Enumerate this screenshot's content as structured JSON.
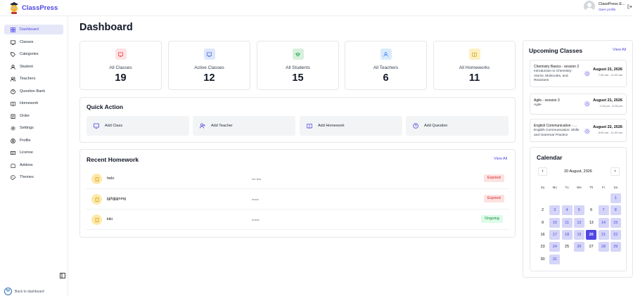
{
  "app": {
    "name": "ClassPress"
  },
  "user": {
    "name": "ClassPress E...",
    "link": "Open profile"
  },
  "sidebar": {
    "items": [
      {
        "label": "Dashboard",
        "icon": "grid-icon"
      },
      {
        "label": "Classes",
        "icon": "monitor-icon"
      },
      {
        "label": "Categories",
        "icon": "tag-icon"
      },
      {
        "label": "Student",
        "icon": "user-icon"
      },
      {
        "label": "Teachers",
        "icon": "users-icon"
      },
      {
        "label": "Question Bank",
        "icon": "help-circle-icon"
      },
      {
        "label": "Homework",
        "icon": "book-icon"
      },
      {
        "label": "Order",
        "icon": "clipboard-icon"
      },
      {
        "label": "Settings",
        "icon": "gear-icon"
      },
      {
        "label": "Profile",
        "icon": "user-circle-icon"
      },
      {
        "label": "License",
        "icon": "license-icon"
      },
      {
        "label": "Addons",
        "icon": "puzzle-icon"
      },
      {
        "label": "Themes",
        "icon": "palette-icon"
      }
    ],
    "back_label": "Back to dashboard"
  },
  "page": {
    "title": "Dashboard"
  },
  "stats": [
    {
      "label": "All Classes",
      "value": "19",
      "bg": "#fde2e4",
      "color": "#ef4444"
    },
    {
      "label": "Active Classes",
      "value": "12",
      "bg": "#dde6fb",
      "color": "#4f6fd9"
    },
    {
      "label": "All Students",
      "value": "15",
      "bg": "#d6f0dc",
      "color": "#16a34a"
    },
    {
      "label": "All Teachers",
      "value": "6",
      "bg": "#d9ebfb",
      "color": "#3b82f6"
    },
    {
      "label": "All Homeworks",
      "value": "11",
      "bg": "#fdf0c2",
      "color": "#d29a06"
    }
  ],
  "quick_action": {
    "title": "Quick Action",
    "items": [
      {
        "label": "Add Class"
      },
      {
        "label": "Add Teacher"
      },
      {
        "label": "Add Homework"
      },
      {
        "label": "Add Question"
      }
    ]
  },
  "recent_homework": {
    "title": "Recent Homework",
    "view_all": "View All",
    "items": [
      {
        "name": "helo",
        "desc": "me test",
        "status": "Expired"
      },
      {
        "name": "jgjhjjjgjnmg",
        "desc": "mnns",
        "status": "Expired"
      },
      {
        "name": "kiki",
        "desc": "hnshs",
        "status": "Ongoing"
      }
    ]
  },
  "upcoming": {
    "title": "Upcoming Classes",
    "view_all": "View All",
    "items": [
      {
        "title": "Chemistry Basics - session 2",
        "desc": "Introduction to Chemistry: Atoms, Molecules, and Reactions",
        "date": "August 21, 2026",
        "time": "7:00 am - 11:00 am"
      },
      {
        "title": "Agile - session 3",
        "desc": "Agile",
        "date": "August 21, 2026",
        "time": "2:15 pm - 6:16 pm"
      },
      {
        "title": "English Communication - ...",
        "desc": "English Communication: Skills and Grammar Practice",
        "date": "August 22, 2026",
        "time": "8:00 am - 11:00 am"
      }
    ]
  },
  "calendar": {
    "title": "Calendar",
    "month_label": "20 August, 2026",
    "prev": "‹",
    "next": "›",
    "weekdays": [
      "Su",
      "Mo",
      "Tu",
      "We",
      "Th",
      "Fr",
      "Sa"
    ],
    "first_weekday": 6,
    "days_in_month": 31,
    "today": 20,
    "highlighted": [
      1,
      3,
      4,
      5,
      7,
      8,
      10,
      11,
      12,
      14,
      15,
      17,
      18,
      19,
      21,
      22,
      24,
      26,
      28,
      29,
      31
    ],
    "accent": "#4f46e5"
  }
}
